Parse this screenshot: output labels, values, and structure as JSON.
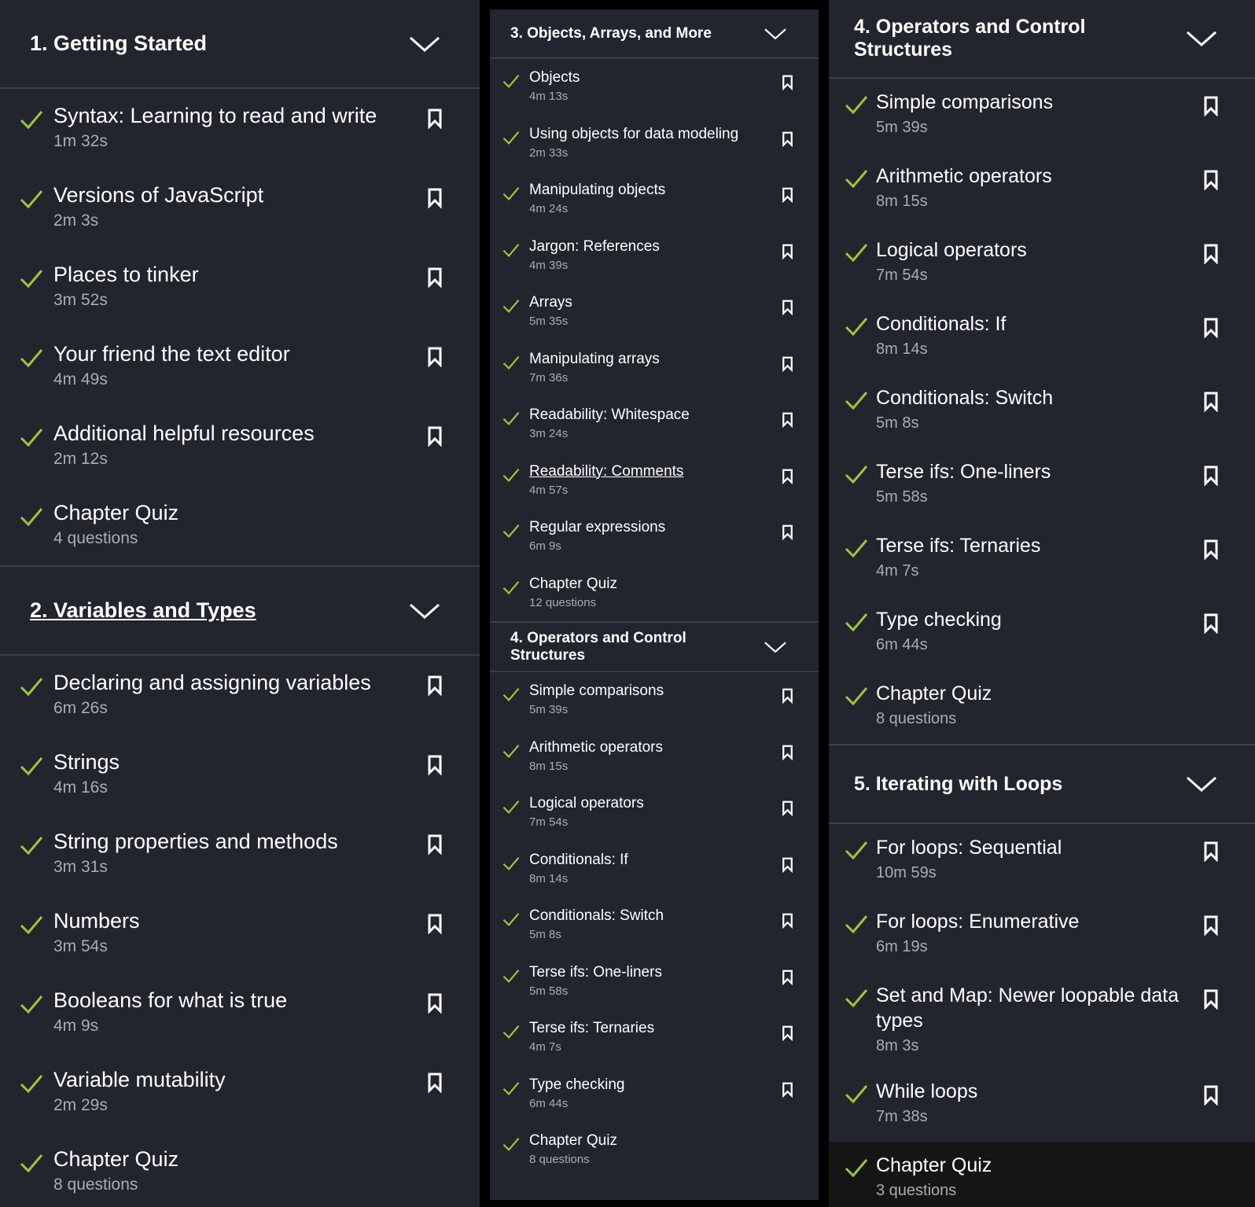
{
  "colors": {
    "panel_bg": "#22252d",
    "divider": "#3b3f48",
    "check": "#9bc53d",
    "text": "#ffffff",
    "subtext": "#a9acb3",
    "active_bg": "#151515"
  },
  "icons": {
    "check": "check-icon",
    "bookmark": "bookmark-icon",
    "chevron": "chevron-down-icon"
  },
  "col1": {
    "ch1": {
      "title": "1. Getting Started",
      "items": [
        {
          "title": "Syntax: Learning to read and write",
          "sub": "1m 32s"
        },
        {
          "title": "Versions of JavaScript",
          "sub": "2m 3s"
        },
        {
          "title": "Places to tinker",
          "sub": "3m 52s"
        },
        {
          "title": "Your friend the text editor",
          "sub": "4m 49s"
        },
        {
          "title": "Additional helpful resources",
          "sub": "2m 12s"
        },
        {
          "title": "Chapter Quiz",
          "sub": "4 questions"
        }
      ]
    },
    "ch2": {
      "title": "2. Variables and Types",
      "items": [
        {
          "title": "Declaring and assigning variables",
          "sub": "6m 26s"
        },
        {
          "title": "Strings",
          "sub": "4m 16s"
        },
        {
          "title": "String properties and methods",
          "sub": "3m 31s"
        },
        {
          "title": "Numbers",
          "sub": "3m 54s"
        },
        {
          "title": "Booleans for what is true",
          "sub": "4m 9s"
        },
        {
          "title": "Variable mutability",
          "sub": "2m 29s"
        },
        {
          "title": "Chapter Quiz",
          "sub": "8 questions"
        }
      ]
    }
  },
  "col2": {
    "ch3": {
      "title": "3. Objects, Arrays, and More",
      "items": [
        {
          "title": "Objects",
          "sub": "4m 13s"
        },
        {
          "title": "Using objects for data modeling",
          "sub": "2m 33s"
        },
        {
          "title": "Manipulating objects",
          "sub": "4m 24s"
        },
        {
          "title": "Jargon: References",
          "sub": "4m 39s"
        },
        {
          "title": "Arrays",
          "sub": "5m 35s"
        },
        {
          "title": "Manipulating arrays",
          "sub": "7m 36s"
        },
        {
          "title": "Readability: Whitespace",
          "sub": "3m 24s"
        },
        {
          "title": "Readability: Comments",
          "sub": "4m 57s"
        },
        {
          "title": "Regular expressions",
          "sub": "6m 9s"
        },
        {
          "title": "Chapter Quiz",
          "sub": "12 questions"
        }
      ]
    },
    "ch4": {
      "title": "4. Operators and Control Structures",
      "items": [
        {
          "title": "Simple comparisons",
          "sub": "5m 39s"
        },
        {
          "title": "Arithmetic operators",
          "sub": "8m 15s"
        },
        {
          "title": "Logical operators",
          "sub": "7m 54s"
        },
        {
          "title": "Conditionals: If",
          "sub": "8m 14s"
        },
        {
          "title": "Conditionals: Switch",
          "sub": "5m 8s"
        },
        {
          "title": "Terse ifs: One-liners",
          "sub": "5m 58s"
        },
        {
          "title": "Terse ifs: Ternaries",
          "sub": "4m 7s"
        },
        {
          "title": "Type checking",
          "sub": "6m 44s"
        },
        {
          "title": "Chapter Quiz",
          "sub": "8 questions"
        }
      ]
    }
  },
  "col3": {
    "ch4": {
      "title": "4. Operators and Control Structures",
      "items": [
        {
          "title": "Simple comparisons",
          "sub": "5m 39s"
        },
        {
          "title": "Arithmetic operators",
          "sub": "8m 15s"
        },
        {
          "title": "Logical operators",
          "sub": "7m 54s"
        },
        {
          "title": "Conditionals: If",
          "sub": "8m 14s"
        },
        {
          "title": "Conditionals: Switch",
          "sub": "5m 8s"
        },
        {
          "title": "Terse ifs: One-liners",
          "sub": "5m 58s"
        },
        {
          "title": "Terse ifs: Ternaries",
          "sub": "4m 7s"
        },
        {
          "title": "Type checking",
          "sub": "6m 44s"
        },
        {
          "title": "Chapter Quiz",
          "sub": "8 questions"
        }
      ]
    },
    "ch5": {
      "title": "5. Iterating with Loops",
      "items": [
        {
          "title": "For loops: Sequential",
          "sub": "10m 59s"
        },
        {
          "title": "For loops: Enumerative",
          "sub": "6m 19s"
        },
        {
          "title": "Set and Map: Newer loopable data types",
          "sub": "8m 3s"
        },
        {
          "title": "While loops",
          "sub": "7m 38s"
        },
        {
          "title": "Chapter Quiz",
          "sub": "3 questions"
        }
      ]
    }
  }
}
